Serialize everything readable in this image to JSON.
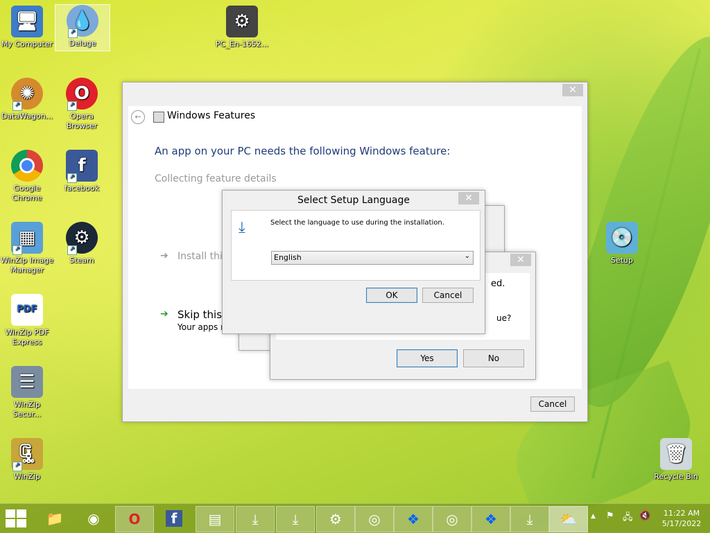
{
  "desktop": {
    "icons": [
      {
        "label": "My Computer"
      },
      {
        "label": "Deluge"
      },
      {
        "label": "PC_En-1652..."
      },
      {
        "label": "DataWagon..."
      },
      {
        "label": "Opera Browser"
      },
      {
        "label": "Google Chrome"
      },
      {
        "label": "facebook"
      },
      {
        "label": "WinZip Image Manager"
      },
      {
        "label": "Steam"
      },
      {
        "label": "Setup"
      },
      {
        "label": "WinZip PDF Express"
      },
      {
        "label": "WinZip Secur..."
      },
      {
        "label": "WinZip"
      },
      {
        "label": "Recycle Bin"
      }
    ]
  },
  "windows_features": {
    "title": "Windows Features",
    "heading": "An app on your PC needs the following Windows feature:",
    "status": "Collecting feature details",
    "option_install": "Install thi",
    "option_skip": "Skip this",
    "option_skip_sub": "Your apps m",
    "cancel_label": "Cancel",
    "close_label": "✕"
  },
  "question_dialog": {
    "text_tail": "ed.",
    "question_tail": "ue?",
    "yes_label": "Yes",
    "no_label": "No",
    "close_label": "✕"
  },
  "setup_language": {
    "title": "Select Setup Language",
    "instruction": "Select the language to use during the installation.",
    "selected_language": "English",
    "ok_label": "OK",
    "cancel_label": "Cancel",
    "close_label": "✕"
  },
  "taskbar": {
    "time": "11:22 AM",
    "date": "5/17/2022",
    "tray_up": "▲"
  }
}
